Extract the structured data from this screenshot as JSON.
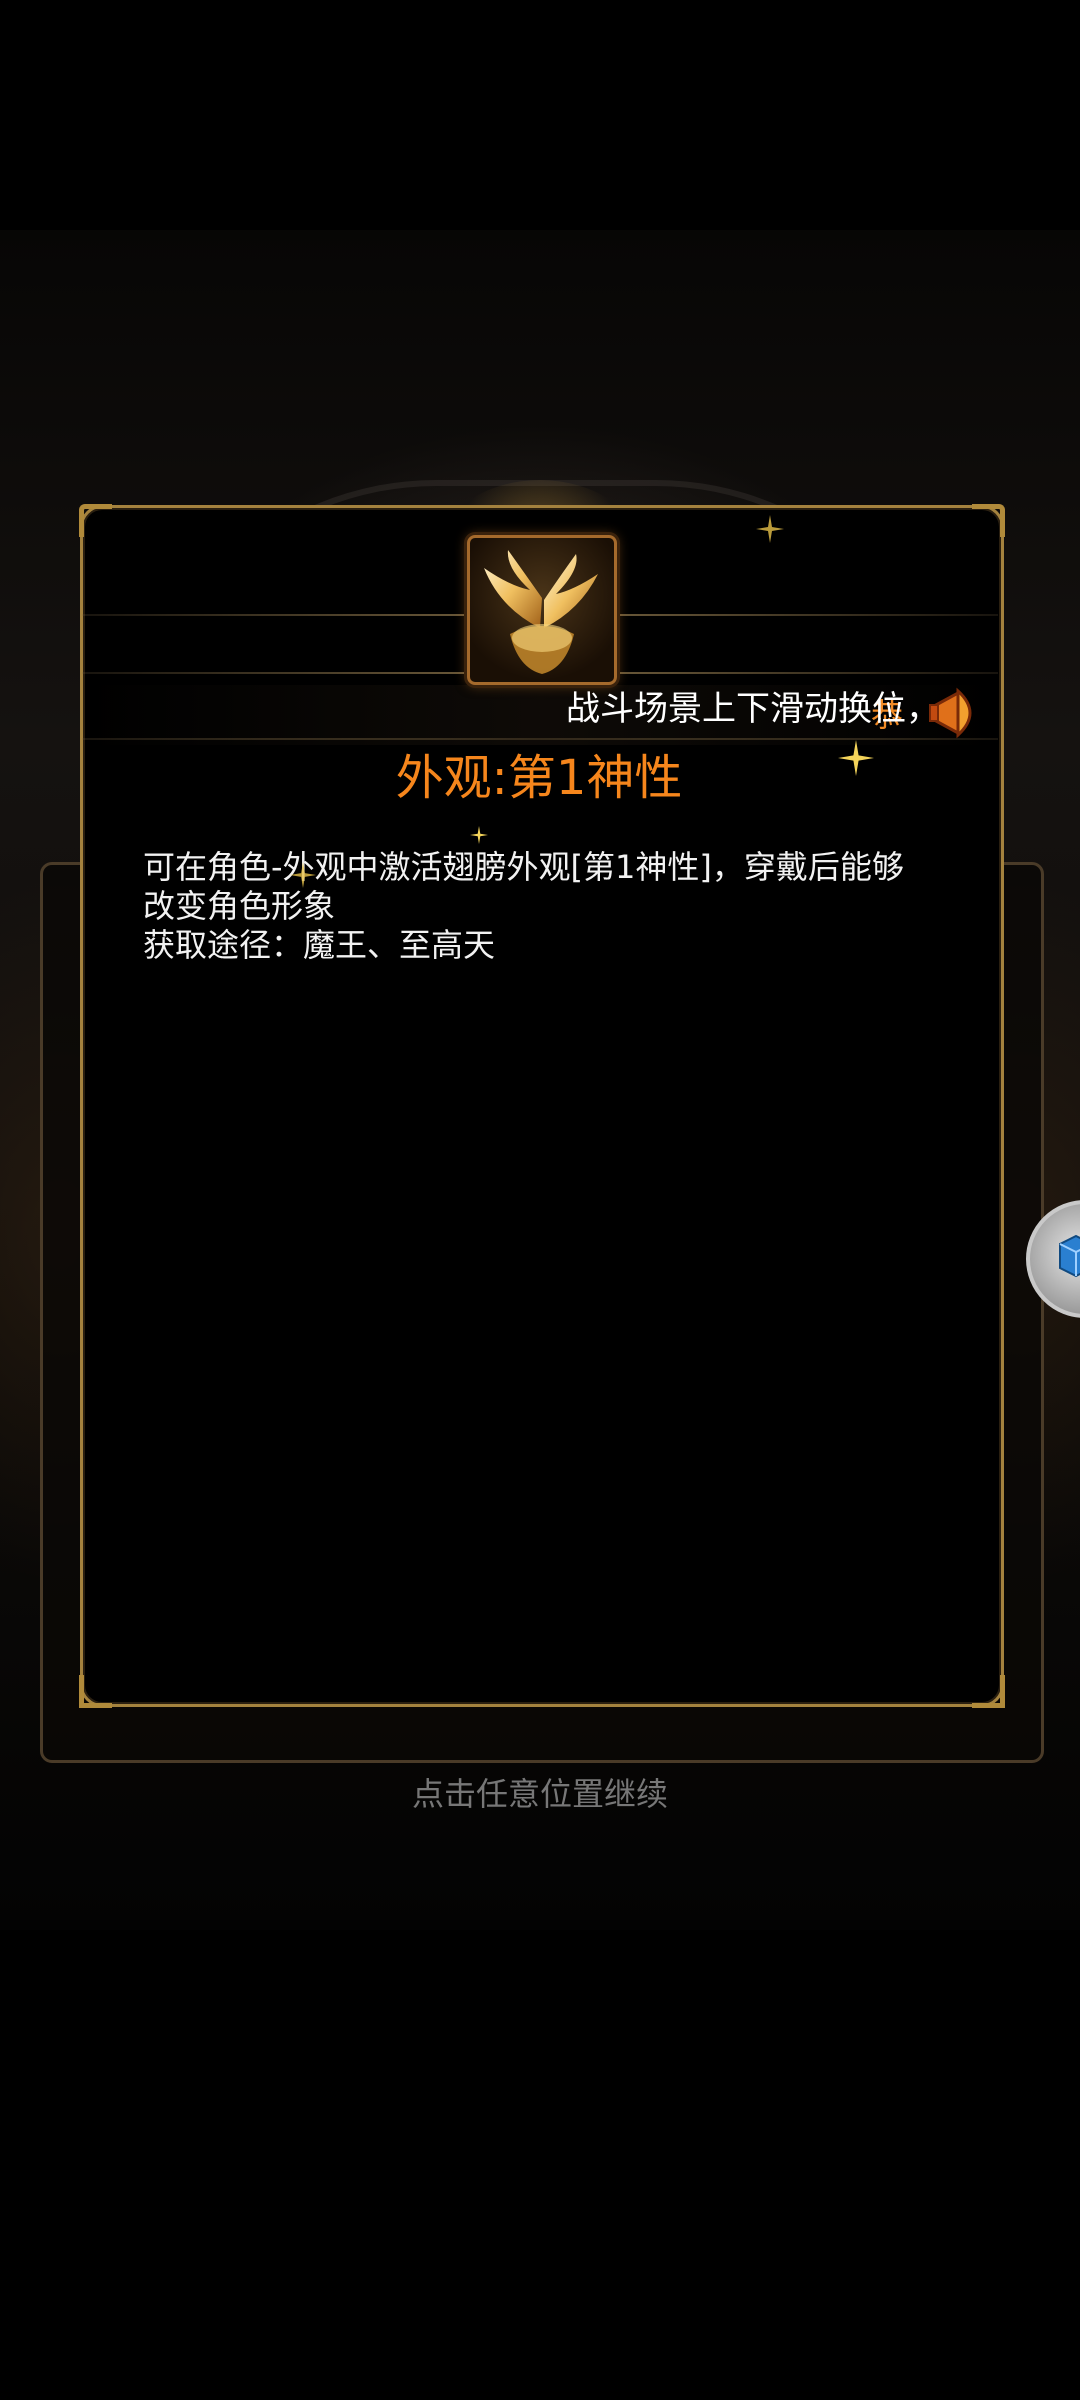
{
  "marquee": {
    "text": "恭",
    "hint": "战斗场景上下滑动换位，"
  },
  "item": {
    "icon": "golden-wings-icon",
    "title": "外观:第1神性",
    "description": [
      "可在角色-外观中激活翅膀外观[第1神性]，穿戴后能够",
      "改变角色形象",
      "获取途径：魔王、至高天"
    ]
  },
  "footer": {
    "continue": "点击任意位置继续"
  },
  "colors": {
    "title": "#f6861c",
    "frame": "#a4823e",
    "marquee": "#f08a26"
  }
}
